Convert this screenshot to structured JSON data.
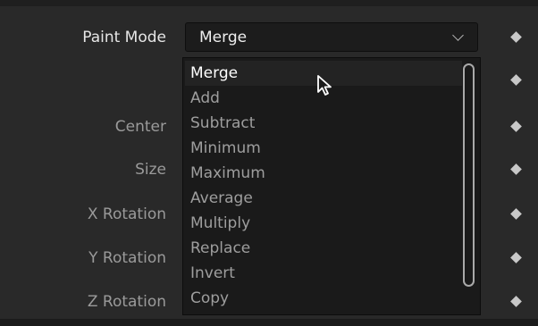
{
  "properties": [
    {
      "label": "Paint Mode",
      "bright": true
    },
    {
      "label": ""
    },
    {
      "label": "Center"
    },
    {
      "label": "Size"
    },
    {
      "label": "X Rotation"
    },
    {
      "label": "Y Rotation"
    },
    {
      "label": "Z Rotation"
    }
  ],
  "paint_mode": {
    "selected": "Merge",
    "options": [
      "Merge",
      "Add",
      "Subtract",
      "Minimum",
      "Maximum",
      "Average",
      "Multiply",
      "Replace",
      "Invert",
      "Copy"
    ]
  },
  "icons": {
    "keyframe": "keyframe-diamond-icon",
    "chevron": "chevron-down-icon",
    "cursor": "mouse-pointer-icon"
  },
  "colors": {
    "background": "#292929",
    "dropdown_background": "#1a1a1a",
    "label_text": "#9a9a9a",
    "selected_text": "#ffffff"
  }
}
